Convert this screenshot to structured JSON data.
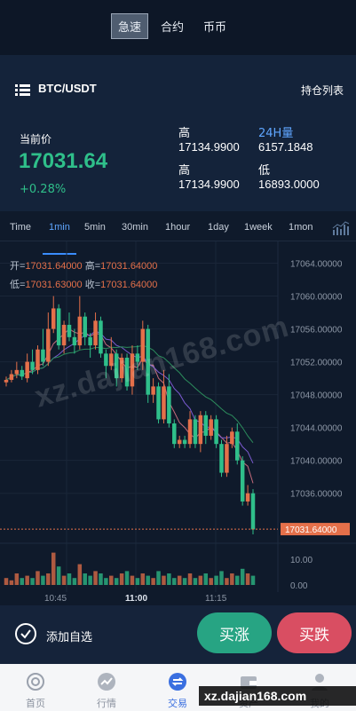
{
  "mode_tabs": [
    {
      "label": "急速",
      "active": true
    },
    {
      "label": "合约",
      "active": false
    },
    {
      "label": "币币",
      "active": false
    }
  ],
  "header": {
    "pair": "BTC/USDT",
    "positions_label": "持仓列表",
    "menu_icon": "list-icon"
  },
  "price": {
    "label": "当前价",
    "value": "17031.64",
    "change": "+0.28%"
  },
  "stats": {
    "high1_label": "高",
    "high1_value": "17134.9900",
    "vol_label": "24H量",
    "vol_value": "6157.1848",
    "high2_label": "高",
    "high2_value": "17134.9900",
    "low_label": "低",
    "low_value": "16893.0000"
  },
  "intervals": [
    {
      "label": "Time",
      "active": false
    },
    {
      "label": "1min",
      "active": true
    },
    {
      "label": "5min",
      "active": false
    },
    {
      "label": "30min",
      "active": false
    },
    {
      "label": "1hour",
      "active": false
    },
    {
      "label": "1day",
      "active": false
    },
    {
      "label": "1week",
      "active": false
    },
    {
      "label": "1mon",
      "active": false
    }
  ],
  "ohlc": {
    "open_label": "开=",
    "open": "17031.64000",
    "high_label": "高=",
    "high": "17031.64000",
    "low_label": "低=",
    "low": "17031.63000",
    "close_label": "收=",
    "close": "17031.64000"
  },
  "chart_data": {
    "type": "candlestick",
    "y_ticks": [
      "17064.00000",
      "17060.00000",
      "17056.00000",
      "17052.00000",
      "17048.00000",
      "17044.00000",
      "17040.00000",
      "17036.00000"
    ],
    "y_range": [
      17031,
      17066
    ],
    "current_price_label": "17031.64000",
    "current_price": 17031.64,
    "x_ticks": [
      "10:45",
      "11:00",
      "11:15"
    ],
    "volume_ticks": [
      "10.00",
      "0.00"
    ],
    "candles": [
      {
        "o": 17049.5,
        "c": 17049.8,
        "h": 17050.2,
        "l": 17049.0
      },
      {
        "o": 17049.8,
        "c": 17050.5,
        "h": 17051.0,
        "l": 17049.5
      },
      {
        "o": 17050.5,
        "c": 17051.0,
        "h": 17052.0,
        "l": 17050.0
      },
      {
        "o": 17051.0,
        "c": 17050.2,
        "h": 17051.5,
        "l": 17049.8
      },
      {
        "o": 17050.0,
        "c": 17052.0,
        "h": 17053.0,
        "l": 17049.5
      },
      {
        "o": 17052.0,
        "c": 17051.0,
        "h": 17053.5,
        "l": 17050.5
      },
      {
        "o": 17051.0,
        "c": 17053.5,
        "h": 17054.0,
        "l": 17050.5
      },
      {
        "o": 17053.5,
        "c": 17052.0,
        "h": 17056.0,
        "l": 17051.5
      },
      {
        "o": 17052.0,
        "c": 17056.0,
        "h": 17058.0,
        "l": 17051.5
      },
      {
        "o": 17056.0,
        "c": 17058.5,
        "h": 17060.0,
        "l": 17055.5
      },
      {
        "o": 17058.5,
        "c": 17054.0,
        "h": 17059.0,
        "l": 17053.5
      },
      {
        "o": 17054.0,
        "c": 17056.5,
        "h": 17057.0,
        "l": 17053.0
      },
      {
        "o": 17056.5,
        "c": 17055.0,
        "h": 17058.0,
        "l": 17054.5
      },
      {
        "o": 17055.0,
        "c": 17054.0,
        "h": 17056.0,
        "l": 17053.0
      },
      {
        "o": 17054.0,
        "c": 17057.5,
        "h": 17060.0,
        "l": 17053.5
      },
      {
        "o": 17057.5,
        "c": 17055.0,
        "h": 17058.0,
        "l": 17054.0
      },
      {
        "o": 17055.0,
        "c": 17054.0,
        "h": 17055.5,
        "l": 17052.5
      },
      {
        "o": 17054.0,
        "c": 17057.0,
        "h": 17058.0,
        "l": 17053.5
      },
      {
        "o": 17057.0,
        "c": 17053.0,
        "h": 17057.5,
        "l": 17052.5
      },
      {
        "o": 17053.0,
        "c": 17051.5,
        "h": 17053.5,
        "l": 17050.0
      },
      {
        "o": 17051.5,
        "c": 17053.0,
        "h": 17055.0,
        "l": 17051.0
      },
      {
        "o": 17053.0,
        "c": 17050.0,
        "h": 17053.5,
        "l": 17049.0
      },
      {
        "o": 17050.0,
        "c": 17052.5,
        "h": 17053.0,
        "l": 17049.5
      },
      {
        "o": 17052.5,
        "c": 17049.0,
        "h": 17053.0,
        "l": 17048.5
      },
      {
        "o": 17049.0,
        "c": 17053.0,
        "h": 17054.0,
        "l": 17048.0
      },
      {
        "o": 17053.0,
        "c": 17052.0,
        "h": 17054.0,
        "l": 17051.0
      },
      {
        "o": 17052.0,
        "c": 17056.0,
        "h": 17057.0,
        "l": 17051.0
      },
      {
        "o": 17056.0,
        "c": 17048.0,
        "h": 17056.5,
        "l": 17047.0
      },
      {
        "o": 17048.0,
        "c": 17049.0,
        "h": 17050.0,
        "l": 17047.0
      },
      {
        "o": 17049.0,
        "c": 17045.0,
        "h": 17049.5,
        "l": 17044.5
      },
      {
        "o": 17045.0,
        "c": 17049.0,
        "h": 17051.0,
        "l": 17044.5
      },
      {
        "o": 17049.0,
        "c": 17044.5,
        "h": 17050.5,
        "l": 17044.0
      },
      {
        "o": 17044.5,
        "c": 17042.0,
        "h": 17045.0,
        "l": 17041.5
      },
      {
        "o": 17042.0,
        "c": 17042.5,
        "h": 17043.0,
        "l": 17041.5
      },
      {
        "o": 17042.5,
        "c": 17042.0,
        "h": 17043.0,
        "l": 17041.5
      },
      {
        "o": 17042.0,
        "c": 17045.0,
        "h": 17046.0,
        "l": 17041.5
      },
      {
        "o": 17045.0,
        "c": 17042.0,
        "h": 17045.5,
        "l": 17041.5
      },
      {
        "o": 17042.0,
        "c": 17045.5,
        "h": 17046.0,
        "l": 17041.0
      },
      {
        "o": 17045.5,
        "c": 17043.0,
        "h": 17046.0,
        "l": 17042.0
      },
      {
        "o": 17043.0,
        "c": 17045.0,
        "h": 17045.5,
        "l": 17042.5
      },
      {
        "o": 17045.0,
        "c": 17042.0,
        "h": 17045.5,
        "l": 17041.5
      },
      {
        "o": 17042.0,
        "c": 17038.5,
        "h": 17042.5,
        "l": 17038.0
      },
      {
        "o": 17038.5,
        "c": 17042.0,
        "h": 17043.0,
        "l": 17038.0
      },
      {
        "o": 17042.0,
        "c": 17043.5,
        "h": 17044.0,
        "l": 17041.5
      },
      {
        "o": 17043.5,
        "c": 17040.0,
        "h": 17044.5,
        "l": 17039.5
      },
      {
        "o": 17040.0,
        "c": 17035.0,
        "h": 17040.5,
        "l": 17034.5
      },
      {
        "o": 17035.0,
        "c": 17036.0,
        "h": 17037.0,
        "l": 17034.5
      },
      {
        "o": 17036.0,
        "c": 17031.6,
        "h": 17036.5,
        "l": 17031.0
      }
    ],
    "volumes": [
      0.3,
      0.2,
      0.5,
      0.3,
      0.4,
      0.3,
      0.6,
      0.4,
      0.5,
      1.4,
      0.8,
      0.4,
      0.5,
      0.3,
      0.9,
      0.5,
      0.4,
      0.6,
      0.5,
      0.3,
      0.4,
      0.3,
      0.5,
      0.6,
      0.4,
      0.3,
      0.5,
      0.4,
      0.3,
      0.6,
      0.4,
      0.5,
      0.3,
      0.4,
      0.3,
      0.5,
      0.3,
      0.4,
      0.5,
      0.3,
      0.4,
      0.6,
      0.3,
      0.5,
      0.4,
      0.7,
      0.5,
      0.4
    ]
  },
  "actions": {
    "add_fav_label": "添加自选",
    "buy_label": "买涨",
    "sell_label": "买跌"
  },
  "tabbar": [
    {
      "label": "首页",
      "icon": "home-icon",
      "active": false
    },
    {
      "label": "行情",
      "icon": "market-icon",
      "active": false
    },
    {
      "label": "交易",
      "icon": "trade-icon",
      "active": true
    },
    {
      "label": "资产",
      "icon": "wallet-icon",
      "active": false
    },
    {
      "label": "我的",
      "icon": "user-icon",
      "active": false
    }
  ],
  "watermark": {
    "diagonal": "xz.dajian168.com",
    "tag": "xz.dajian168.com"
  },
  "colors": {
    "up": "#e4704a",
    "down": "#2fbf8a",
    "accent": "#3a8dff"
  }
}
